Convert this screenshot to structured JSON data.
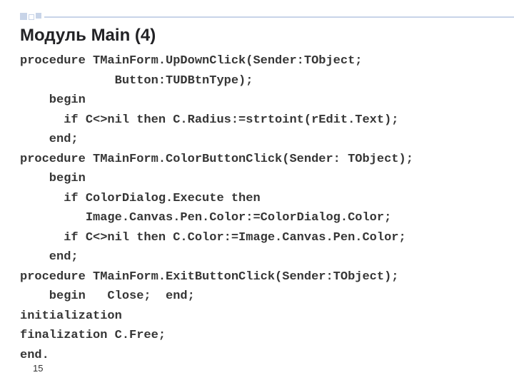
{
  "title": "Модуль Main (4)",
  "page_number": "15",
  "code_lines": [
    "procedure TMainForm.UpDownClick(Sender:TObject;",
    "             Button:TUDBtnType);",
    "    begin",
    "      if C<>nil then C.Radius:=strtoint(rEdit.Text);",
    "    end;",
    "procedure TMainForm.ColorButtonClick(Sender: TObject);",
    "    begin",
    "      if ColorDialog.Execute then",
    "         Image.Canvas.Pen.Color:=ColorDialog.Color;",
    "      if C<>nil then C.Color:=Image.Canvas.Pen.Color;",
    "    end;",
    "procedure TMainForm.ExitButtonClick(Sender:TObject);",
    "    begin   Close;  end;",
    "initialization",
    "finalization C.Free;",
    "end."
  ]
}
